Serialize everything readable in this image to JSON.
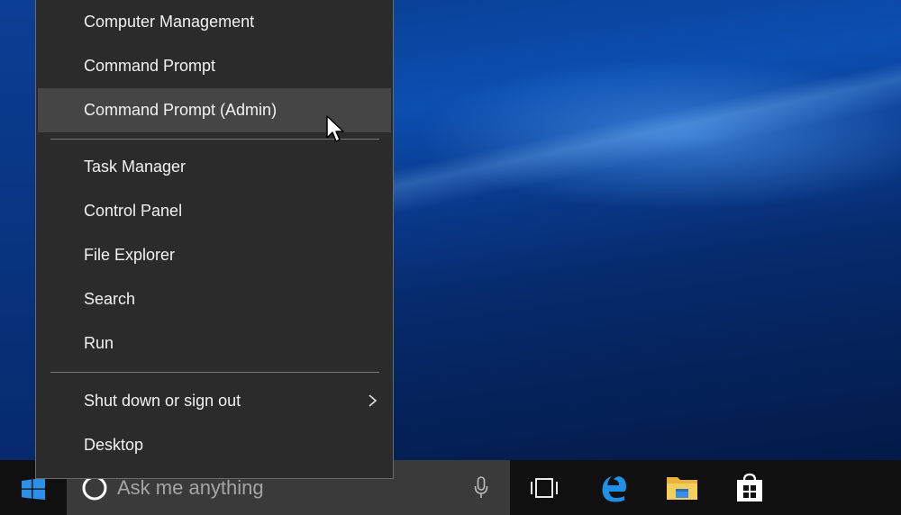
{
  "menu": {
    "items": [
      {
        "label": "Computer Management"
      },
      {
        "label": "Command Prompt"
      },
      {
        "label": "Command Prompt (Admin)"
      },
      {
        "label": "Task Manager"
      },
      {
        "label": "Control Panel"
      },
      {
        "label": "File Explorer"
      },
      {
        "label": "Search"
      },
      {
        "label": "Run"
      },
      {
        "label": "Shut down or sign out"
      },
      {
        "label": "Desktop"
      }
    ],
    "hovered": "Command Prompt (Admin)"
  },
  "taskbar": {
    "search_placeholder": "Ask me anything",
    "icons": [
      "windows-start-icon",
      "cortana-circle-icon",
      "microphone-icon",
      "task-view-icon",
      "edge-icon",
      "file-explorer-icon",
      "store-icon"
    ]
  },
  "colors": {
    "menu_bg": "#2b2b2b",
    "menu_hover": "#454545",
    "taskbar_bg": "#101010",
    "search_bg": "#3a3a3a",
    "accent_blue": "#1e90e6"
  }
}
